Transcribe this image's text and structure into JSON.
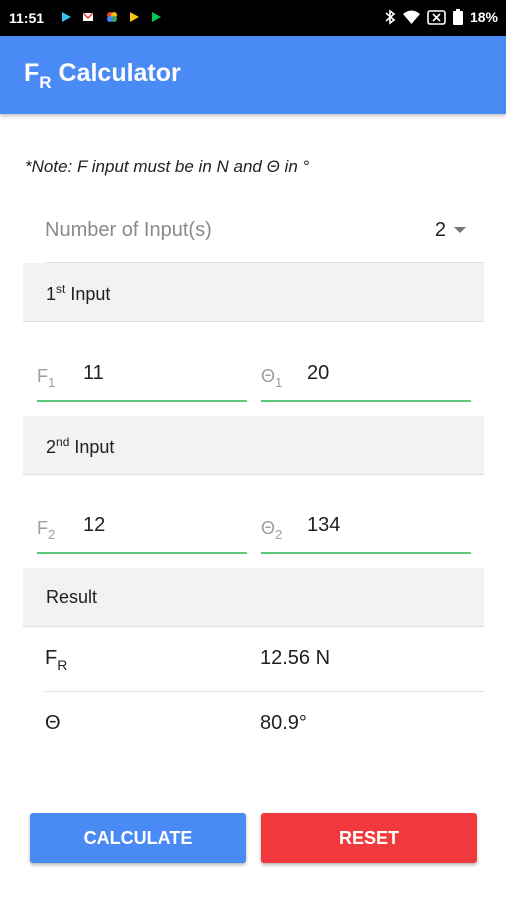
{
  "status_bar": {
    "time": "11:51",
    "battery": "18%",
    "icons": [
      "play-store-icon",
      "gmail-icon",
      "photos-icon",
      "play-store-icon",
      "play-store-icon",
      "bluetooth-icon",
      "wifi-icon",
      "data-off-icon",
      "battery-icon"
    ]
  },
  "app_bar": {
    "title_main": "F",
    "title_sub": "R",
    "title_rest": " Calculator",
    "color": "#4a8af4"
  },
  "note": "*Note: F input must be in N and Θ in °",
  "count": {
    "label": "Number of Input(s)",
    "value": "2"
  },
  "inputs": [
    {
      "header": "1",
      "header_sup": "st",
      "header_rest": " Input",
      "force_label": "F",
      "force_sub": "1",
      "force_value": "11",
      "angle_label": "Θ",
      "angle_sub": "1",
      "angle_value": "20"
    },
    {
      "header": "2",
      "header_sup": "nd",
      "header_rest": " Input",
      "force_label": "F",
      "force_sub": "2",
      "force_value": "12",
      "angle_label": "Θ",
      "angle_sub": "2",
      "angle_value": "134"
    }
  ],
  "result": {
    "header": "Result",
    "force_name": "F",
    "force_sub": "R",
    "force_value": "12.56 N",
    "angle_name": "Θ",
    "angle_value": "80.9°"
  },
  "buttons": {
    "calculate": "CALCULATE",
    "reset": "RESET",
    "calc_color": "#4a8af4",
    "reset_color": "#f23a3e"
  }
}
